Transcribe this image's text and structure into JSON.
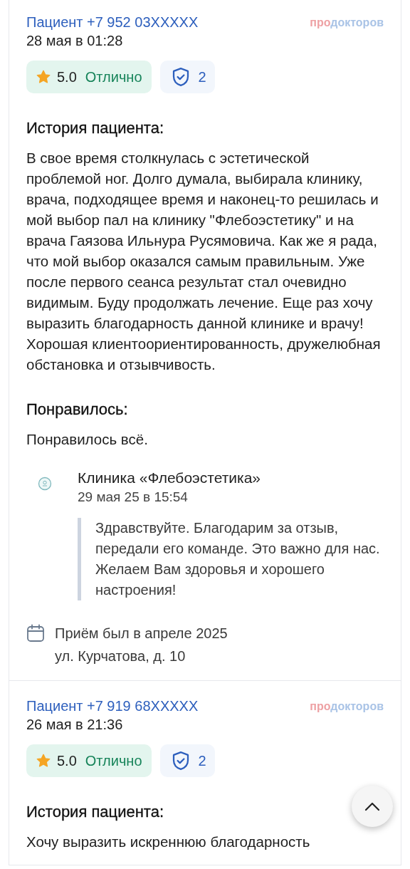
{
  "reviews": [
    {
      "author": "Пациент +7 952 03XXXXX",
      "source_logo": {
        "accent": "про",
        "rest": "докторов"
      },
      "date": "28 мая в 01:28",
      "rating": "5.0",
      "rating_label": "Отлично",
      "verified_count": "2",
      "sections": [
        {
          "heading": "История пациента:",
          "text": "В свое время столкнулась с эстетической проблемой ног. Долго думала, выбирала клинику, врача, подходящее время и наконец-то решилась и мой выбор пал на клинику \"Флебоэстетику\" и на врача Гаязова Ильнура Русямовича. Как же я рада, что мой выбор оказался самым правильным. Уже после первого сеанса результат стал очевидно видимым. Буду продолжать лечение. Еще раз хочу выразить благодарность данной клинике и врачу! Хорошая клиентоориентированность, дружелюбная обстановка и отзывчивость."
        },
        {
          "heading": "Понравилось:",
          "text": "Понравилось всё."
        }
      ],
      "reply": {
        "clinic": "Клиника «Флебоэстетика»",
        "date": "29 мая 25 в 15:54",
        "text": "Здравствуйте. Благодарим за отзыв, передали его команде. Это важно для нас. Желаем Вам здоровья и хорошего настроения!"
      },
      "visit": {
        "when": "Приём был в апреле 2025",
        "address": "ул. Курчатова, д. 10"
      }
    },
    {
      "author": "Пациент +7 919 68XXXXX",
      "source_logo": {
        "accent": "про",
        "rest": "докторов"
      },
      "date": "26 мая в 21:36",
      "rating": "5.0",
      "rating_label": "Отлично",
      "verified_count": "2",
      "sections": [
        {
          "heading": "История пациента:",
          "text": "Хочу выразить искреннюю благодарность"
        }
      ]
    }
  ]
}
